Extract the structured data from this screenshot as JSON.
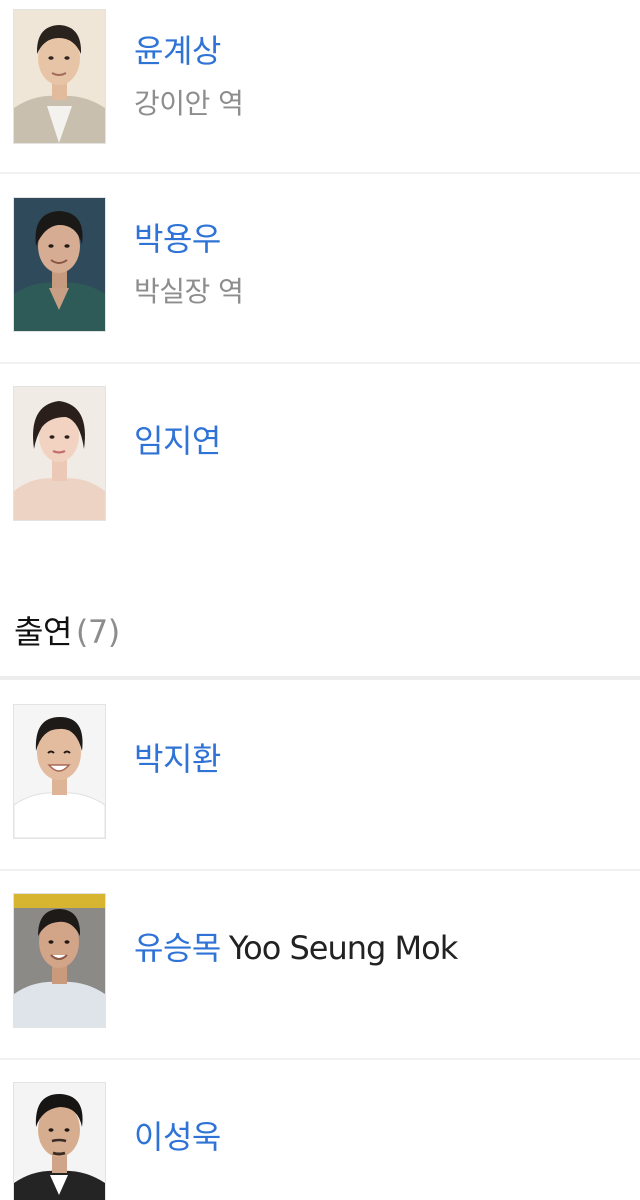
{
  "colors": {
    "link": "#2f73d6",
    "secondary": "#8d8d8d",
    "text": "#111111",
    "divider": "#f1f1f1"
  },
  "main_cast": [
    {
      "name": "윤계상",
      "role": "강이안 역"
    },
    {
      "name": "박용우",
      "role": "박실장 역"
    },
    {
      "name": "임지연"
    }
  ],
  "supporting_section": {
    "title": "출연",
    "count": "(7)"
  },
  "supporting_cast": [
    {
      "name": "박지환"
    },
    {
      "name": "유승목",
      "english_name": "Yoo Seung Mok"
    },
    {
      "name": "이성욱"
    }
  ]
}
